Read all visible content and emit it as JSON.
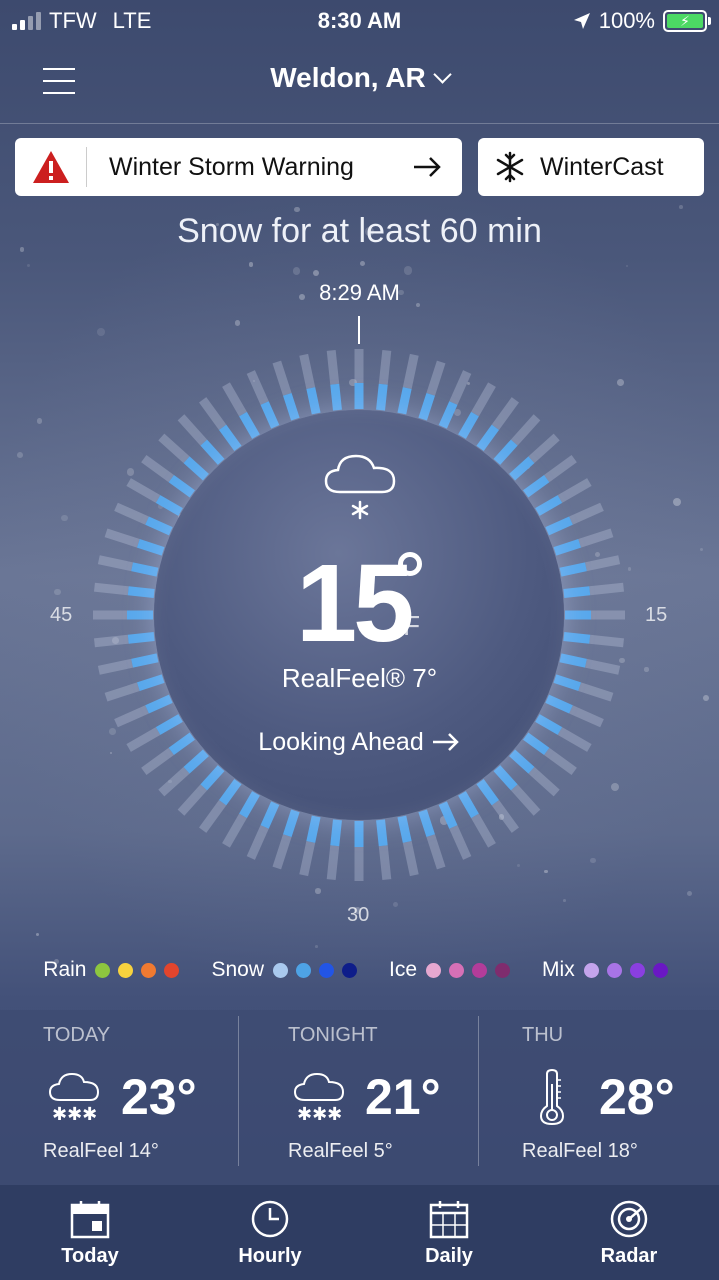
{
  "status_bar": {
    "carrier": "TFW",
    "network": "LTE",
    "time": "8:30 AM",
    "battery": "100%"
  },
  "header": {
    "location": "Weldon, AR"
  },
  "alerts": {
    "warning_label": "Winter Storm Warning",
    "wintercast_label": "WinterCast"
  },
  "current": {
    "precip_message": "Snow for at least 60 min",
    "time_marker": "8:29 AM",
    "temperature": "15",
    "unit": "F",
    "realfeel": "RealFeel® 7°",
    "looking_ahead": "Looking Ahead",
    "scale": {
      "left": "45",
      "right": "15",
      "bottom": "30"
    }
  },
  "legend": [
    {
      "label": "Rain",
      "colors": [
        "#8dc63f",
        "#f7d23e",
        "#f07a31",
        "#e2452d"
      ]
    },
    {
      "label": "Snow",
      "colors": [
        "#a9c9ee",
        "#4ea3e6",
        "#2255e6",
        "#0e1d8a"
      ]
    },
    {
      "label": "Ice",
      "colors": [
        "#e6a8d0",
        "#d670b6",
        "#b33c9a",
        "#7f2c6e"
      ]
    },
    {
      "label": "Mix",
      "colors": [
        "#c4a4ec",
        "#a874e6",
        "#8a3fe0",
        "#6a18c4"
      ]
    }
  ],
  "forecast": [
    {
      "title": "TODAY",
      "temp": "23°",
      "realfeel": "RealFeel 14°",
      "icon": "snow-cloud-icon"
    },
    {
      "title": "TONIGHT",
      "temp": "21°",
      "realfeel": "RealFeel 5°",
      "icon": "snow-cloud-icon"
    },
    {
      "title": "THU",
      "temp": "28°",
      "realfeel": "RealFeel 18°",
      "icon": "thermometer-icon"
    }
  ],
  "tabs": [
    {
      "label": "Today",
      "icon": "calendar-icon"
    },
    {
      "label": "Hourly",
      "icon": "clock-icon"
    },
    {
      "label": "Daily",
      "icon": "calendar-grid-icon"
    },
    {
      "label": "Radar",
      "icon": "radar-icon"
    }
  ],
  "colors": {
    "snow_bar": "#58a8ec",
    "warning_red": "#cc1f1f",
    "battery_green": "#4cd964"
  }
}
